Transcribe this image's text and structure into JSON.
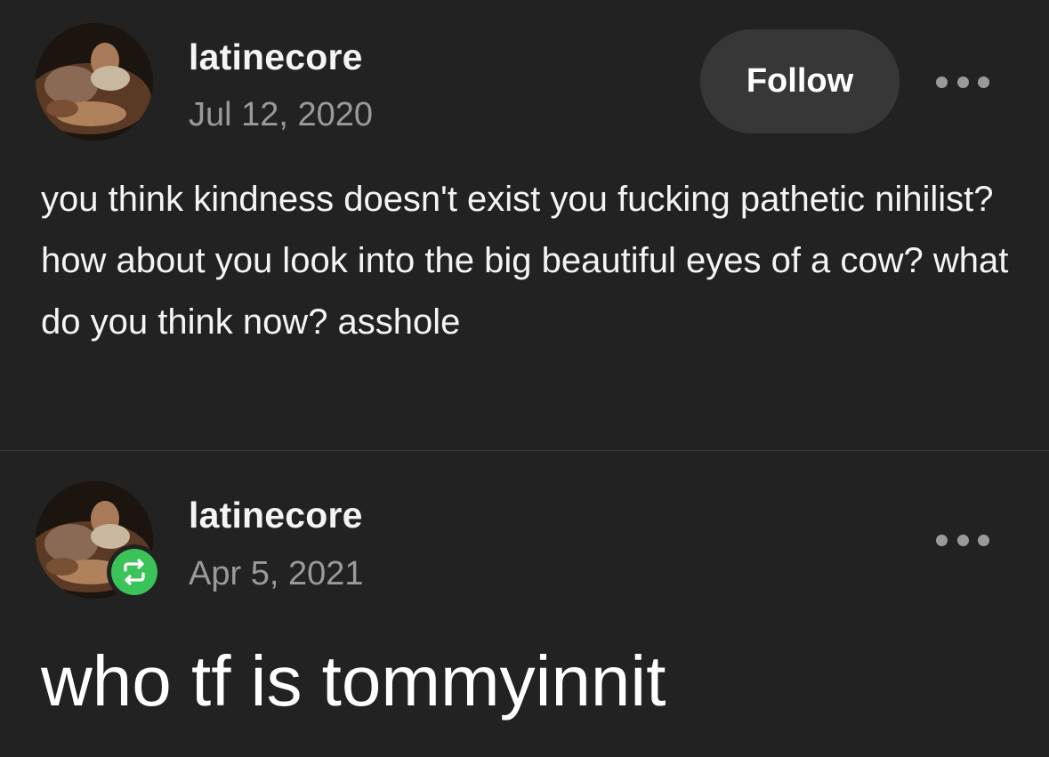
{
  "posts": [
    {
      "username": "latinecore",
      "date": "Jul 12, 2020",
      "follow_label": "Follow",
      "more_icon": "more-horizontal-icon",
      "body": "you think kindness doesn't exist you fucking pathetic nihilist? how about you look into the big beautiful eyes of a cow? what do you think now? asshole"
    },
    {
      "username": "latinecore",
      "date": "Apr 5, 2021",
      "reblog_icon": "reblog-icon",
      "more_icon": "more-horizontal-icon",
      "body": "who tf is tommyinnit"
    }
  ],
  "colors": {
    "background": "#222222",
    "follow_button": "#373737",
    "secondary_text": "#9a9a9a",
    "reblog_green": "#3bc359",
    "divider": "#3a3a3a"
  }
}
